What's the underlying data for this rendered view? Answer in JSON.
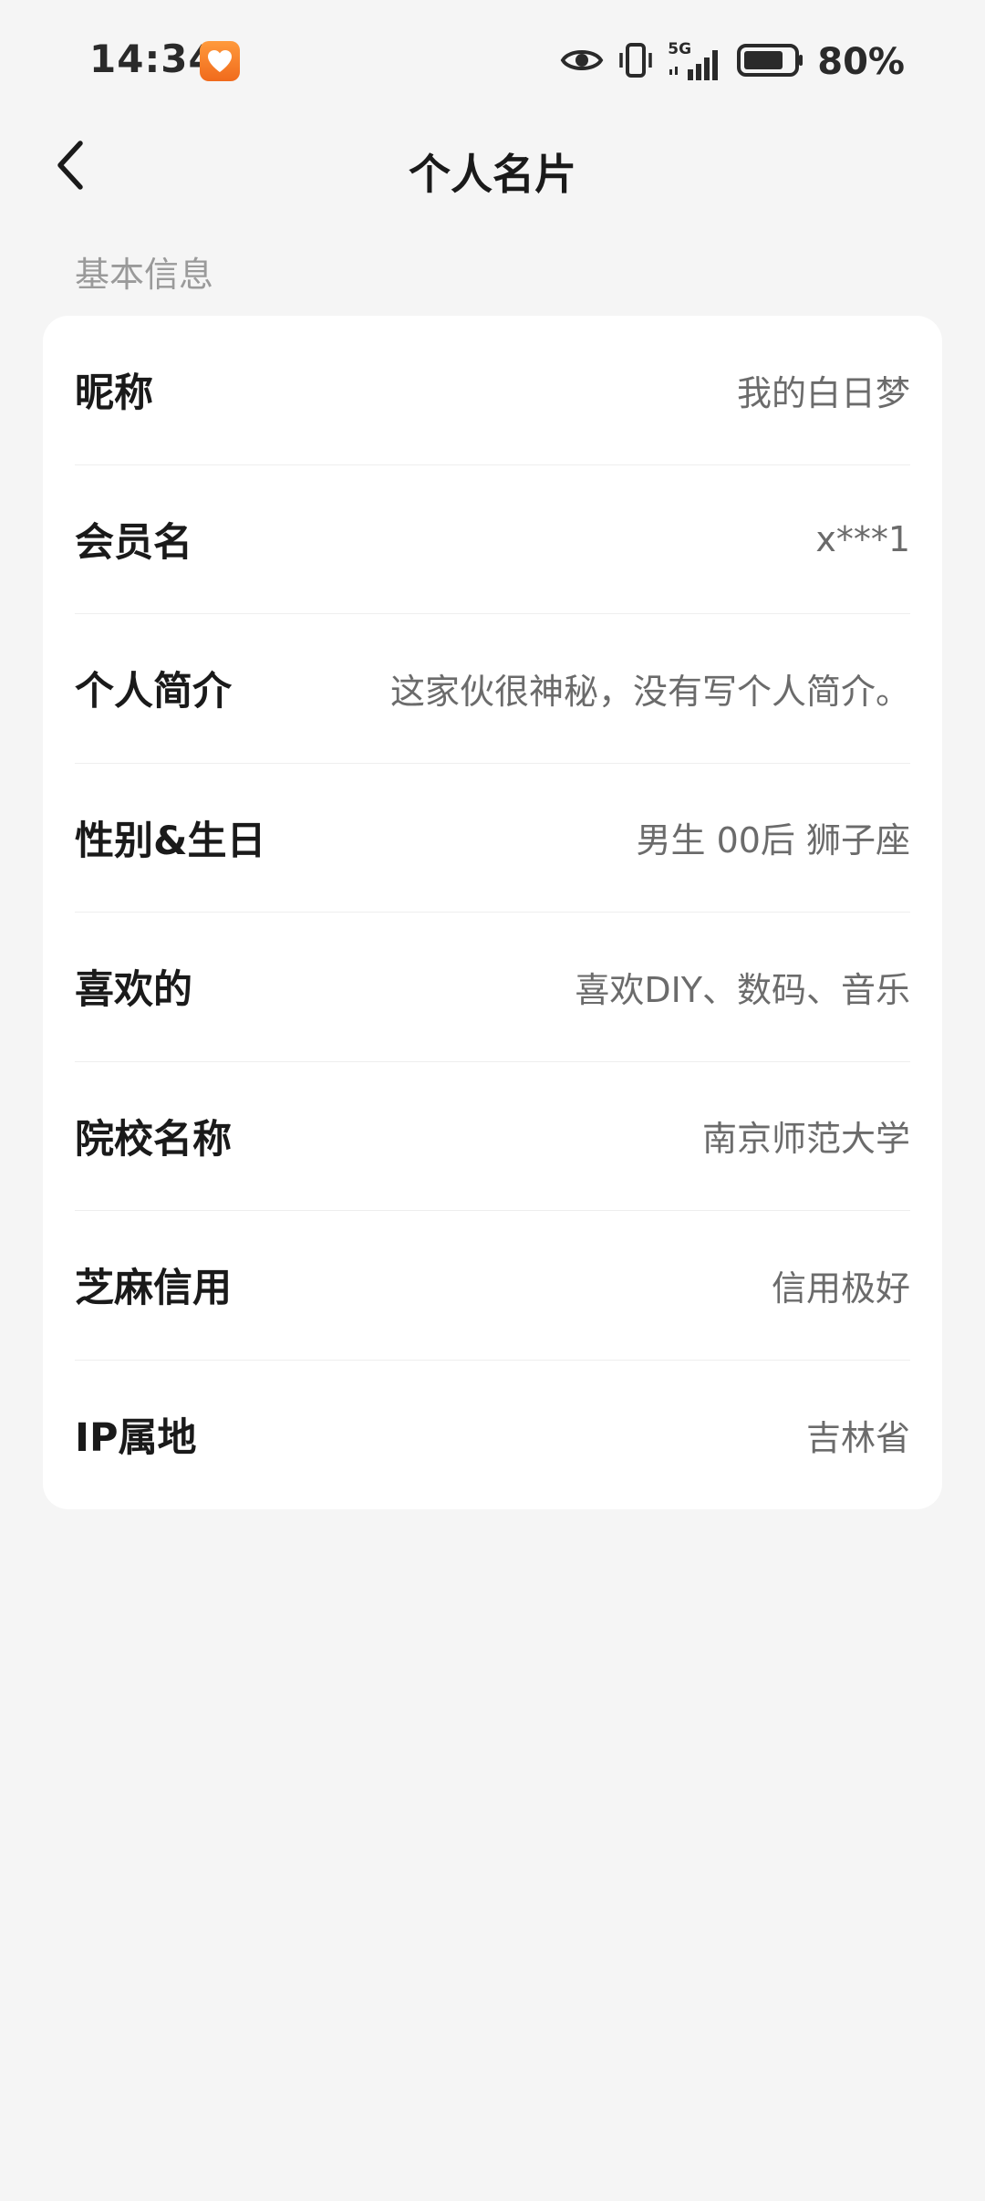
{
  "status_bar": {
    "time": "14:34",
    "battery_percent": "80%",
    "network_label": "5G"
  },
  "nav": {
    "title": "个人名片"
  },
  "section": {
    "header": "基本信息"
  },
  "rows": [
    {
      "label": "昵称",
      "value": "我的白日梦"
    },
    {
      "label": "会员名",
      "value": "x***1"
    },
    {
      "label": "个人简介",
      "value": "这家伙很神秘，没有写个人简介。"
    },
    {
      "label": "性别&生日",
      "value": "男生 00后 狮子座"
    },
    {
      "label": "喜欢的",
      "value": "喜欢DIY、数码、音乐"
    },
    {
      "label": "院校名称",
      "value": "南京师范大学"
    },
    {
      "label": "芝麻信用",
      "value": "信用极好"
    },
    {
      "label": "IP属地",
      "value": "吉林省"
    }
  ],
  "colors": {
    "background": "#f5f5f5",
    "card": "#ffffff",
    "label": "#1a1a1a",
    "value": "#6b6b6b",
    "section_header": "#9a9a9a",
    "notif_icon": "#f57f27"
  },
  "icons": {
    "back": "chevron-left-icon",
    "notification": "heart-app-icon",
    "eye": "eye-icon",
    "vibrate": "vibrate-icon",
    "signal": "signal-icon",
    "battery": "battery-icon"
  }
}
